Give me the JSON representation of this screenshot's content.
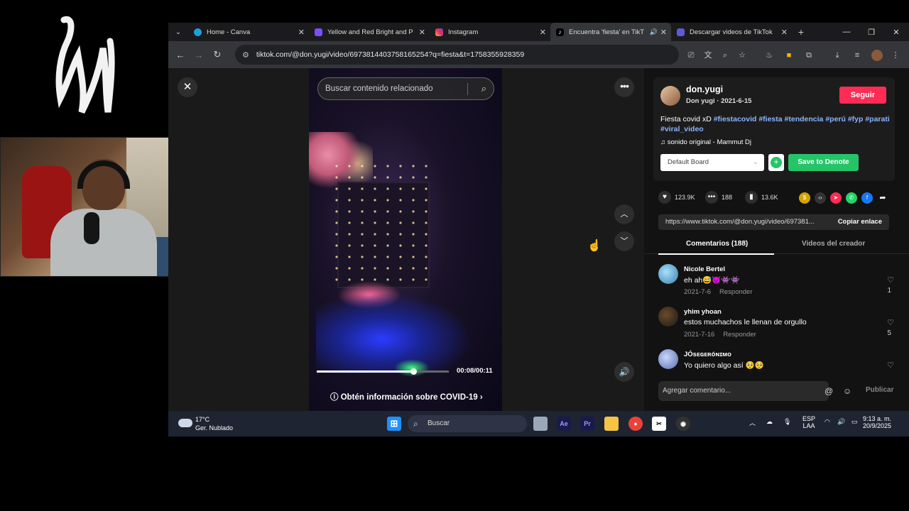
{
  "browser": {
    "tabs": [
      {
        "title": "Home - Canva",
        "color": "#1f9fda"
      },
      {
        "title": "Yellow and Red Bright and P",
        "color": "#7c4dff"
      },
      {
        "title": "Instagram",
        "color": "#e1306c"
      },
      {
        "title": "Encuentra 'fiesta' en TikT",
        "color": "#000000"
      },
      {
        "title": "Descargar videos de TikTok",
        "color": "#5b5bd6"
      }
    ],
    "url": "tiktok.com/@don.yugi/video/6973814403758165254?q=fiesta&t=1758355928359"
  },
  "player": {
    "search_placeholder": "Buscar contenido relacionado",
    "time": "00:08/00:11",
    "progress": 0.73,
    "covid_banner": "Obtén información sobre COVID-19"
  },
  "post": {
    "username": "don.yugi",
    "subtitle": "Don yugi · 2021-6-15",
    "follow_label": "Seguir",
    "desc_text": "Fiesta covid xD",
    "hashtags": [
      "#fiestacovid",
      "#fiesta",
      "#tendencia",
      "#perú",
      "#fyp",
      "#parati",
      "#viral_video"
    ],
    "music": "sonido original - Mammut Dj",
    "board": "Default Board",
    "save_label": "Save to Denote",
    "likes": "123.9K",
    "comments_count": "188",
    "saves": "13.6K",
    "link": "https://www.tiktok.com/@don.yugi/video/697381...",
    "copy_label": "Copiar enlace"
  },
  "comment_tabs": {
    "comments": "Comentarios (188)",
    "creator": "Videos del creador"
  },
  "comments": [
    {
      "name": "Nicole Bertel",
      "text": "eh ah😅😈👾👾",
      "date": "2021-7-6",
      "reply": "Responder",
      "likes": "1"
    },
    {
      "name": "yhim yhoan",
      "text": "estos muchachos le llenan de orgullo",
      "date": "2021-7-16",
      "reply": "Responder",
      "likes": "5"
    },
    {
      "name": "JÓsᴇɢᴇʀóɴɪᴍᴏ",
      "text": "Yo quiero algo así 🥺🥺",
      "date": "",
      "reply": "",
      "likes": ""
    }
  ],
  "add_comment": {
    "placeholder": "Agregar comentario...",
    "publish": "Publicar"
  },
  "taskbar": {
    "temp": "17°C",
    "weather": "Ger. Nublado",
    "search": "Buscar",
    "lang1": "ESP",
    "lang2": "LAA",
    "clock_time": "9:13 a. m.",
    "clock_date": "20/9/2025"
  }
}
